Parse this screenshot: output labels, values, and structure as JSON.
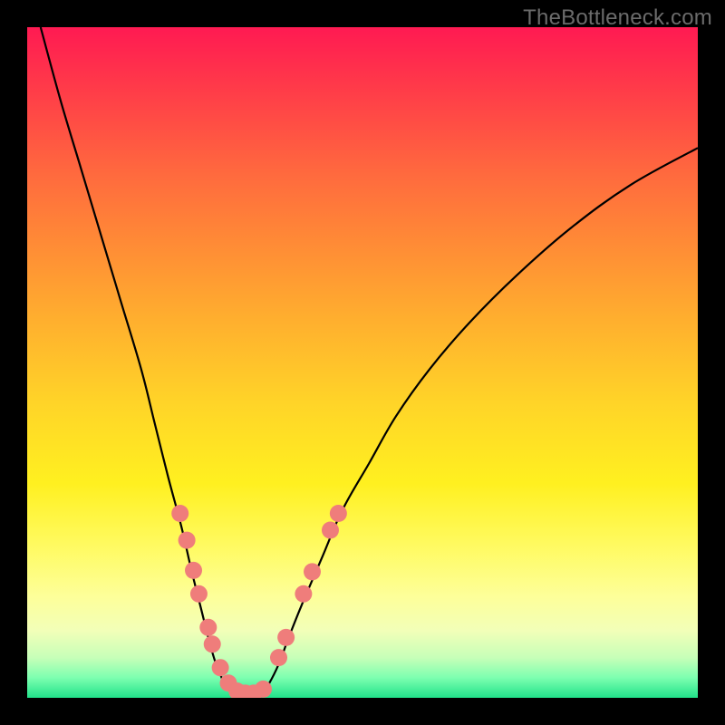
{
  "watermark": "TheBottleneck.com",
  "chart_data": {
    "type": "line",
    "title": "",
    "xlabel": "",
    "ylabel": "",
    "xlim": [
      0,
      100
    ],
    "ylim": [
      0,
      100
    ],
    "background_gradient": {
      "top": "#ff1a52",
      "mid1": "#ffb02e",
      "mid2": "#fff020",
      "bottom": "#21e28a",
      "meaning": "red-high-bottleneck_to_green-low-bottleneck"
    },
    "series": [
      {
        "name": "left-curve",
        "x": [
          2,
          5,
          8,
          11,
          14,
          17,
          19,
          21,
          23,
          24.5,
          26,
          27,
          28,
          29,
          30,
          31
        ],
        "y": [
          100,
          89,
          79,
          69,
          59,
          49,
          41,
          33,
          25.5,
          19,
          13,
          9,
          5.5,
          3,
          1.3,
          0.5
        ]
      },
      {
        "name": "bottom-flat",
        "x": [
          31,
          33,
          35
        ],
        "y": [
          0.4,
          0.3,
          0.5
        ]
      },
      {
        "name": "right-curve",
        "x": [
          35,
          36,
          37.5,
          39,
          41,
          44,
          47,
          51,
          55,
          60,
          66,
          73,
          81,
          90,
          100
        ],
        "y": [
          0.6,
          2,
          5,
          9,
          14,
          21,
          28,
          35,
          42,
          49,
          56,
          63,
          70,
          76.5,
          82
        ]
      }
    ],
    "annotations": {
      "dots_color": "#ef7d7b",
      "dots_meaning": "highlighted-data-points",
      "points": [
        {
          "x": 22.8,
          "y": 27.5
        },
        {
          "x": 23.8,
          "y": 23.5
        },
        {
          "x": 24.8,
          "y": 19.0
        },
        {
          "x": 25.6,
          "y": 15.5
        },
        {
          "x": 27.0,
          "y": 10.5
        },
        {
          "x": 27.6,
          "y": 8.0
        },
        {
          "x": 28.8,
          "y": 4.5
        },
        {
          "x": 30.0,
          "y": 2.2
        },
        {
          "x": 31.3,
          "y": 1.0
        },
        {
          "x": 32.5,
          "y": 0.7
        },
        {
          "x": 33.8,
          "y": 0.7
        },
        {
          "x": 35.2,
          "y": 1.3
        },
        {
          "x": 37.5,
          "y": 6.0
        },
        {
          "x": 38.6,
          "y": 9.0
        },
        {
          "x": 41.2,
          "y": 15.5
        },
        {
          "x": 42.5,
          "y": 18.8
        },
        {
          "x": 45.2,
          "y": 25.0
        },
        {
          "x": 46.4,
          "y": 27.5
        }
      ]
    }
  }
}
